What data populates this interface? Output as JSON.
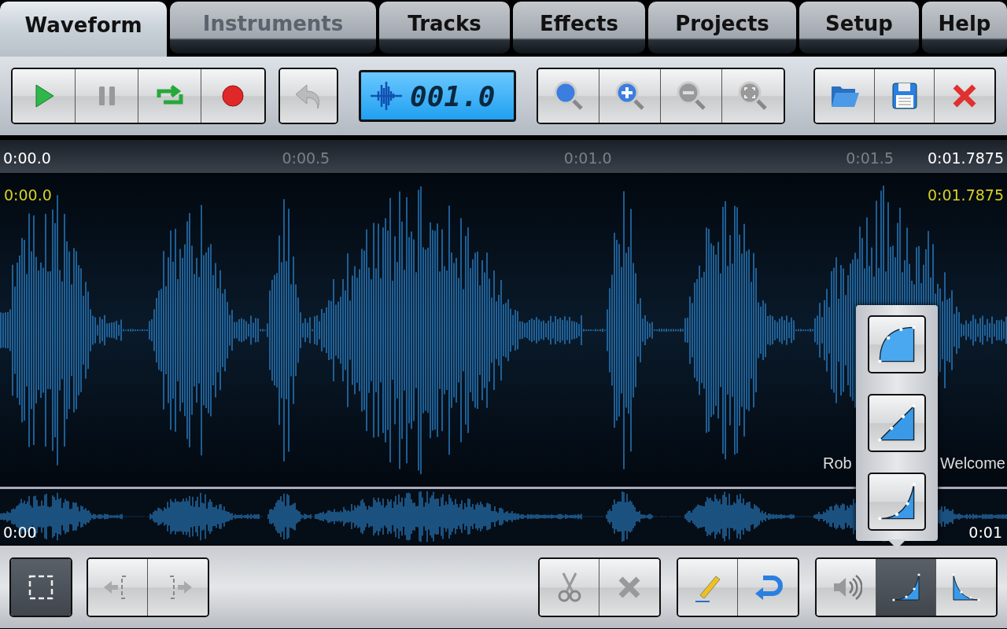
{
  "tabs": [
    {
      "label": "Waveform",
      "selected": true,
      "disabled": false
    },
    {
      "label": "Instruments",
      "selected": false,
      "disabled": true
    },
    {
      "label": "Tracks",
      "selected": false,
      "disabled": false
    },
    {
      "label": "Effects",
      "selected": false,
      "disabled": false
    },
    {
      "label": "Projects",
      "selected": false,
      "disabled": false
    },
    {
      "label": "Setup",
      "selected": false,
      "disabled": false
    },
    {
      "label": "Help",
      "selected": false,
      "disabled": false
    }
  ],
  "counter": "001.0",
  "ruler": {
    "start": "0:00.0",
    "ticks": [
      "0:00.5",
      "0:01.0",
      "0:01.5"
    ],
    "end": "0:01.7875"
  },
  "selection": {
    "start": "0:00.0",
    "end": "0:01.7875"
  },
  "markers": [
    "Rob",
    "Welcome"
  ],
  "overview": {
    "start": "0:00",
    "end": "0:01"
  },
  "bottom_buttons": [
    {
      "selected": true
    },
    {
      "selected": false
    },
    {
      "selected": false
    },
    {
      "selected": false
    },
    {
      "selected": false
    },
    {
      "selected": false
    },
    {
      "selected": false
    },
    {
      "selected": false
    },
    {
      "selected": true
    },
    {
      "selected": false
    }
  ]
}
